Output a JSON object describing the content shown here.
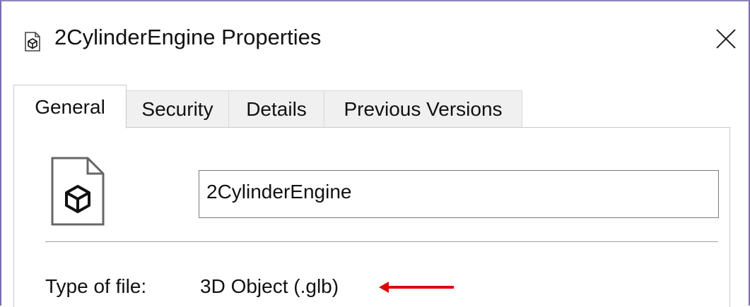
{
  "window": {
    "title": "2CylinderEngine Properties",
    "title_icon": "3d-object-icon",
    "close_icon": "close-icon"
  },
  "tabs": [
    {
      "label": "General",
      "active": true
    },
    {
      "label": "Security",
      "active": false
    },
    {
      "label": "Details",
      "active": false
    },
    {
      "label": "Previous Versions",
      "active": false
    }
  ],
  "general": {
    "file_icon": "3d-object-file-icon",
    "file_name": "2CylinderEngine",
    "type_label": "Type of file:",
    "type_value": "3D Object (.glb)"
  },
  "annotation": {
    "arrow_color": "#e00000",
    "accent_border": "#7b6bb3"
  }
}
